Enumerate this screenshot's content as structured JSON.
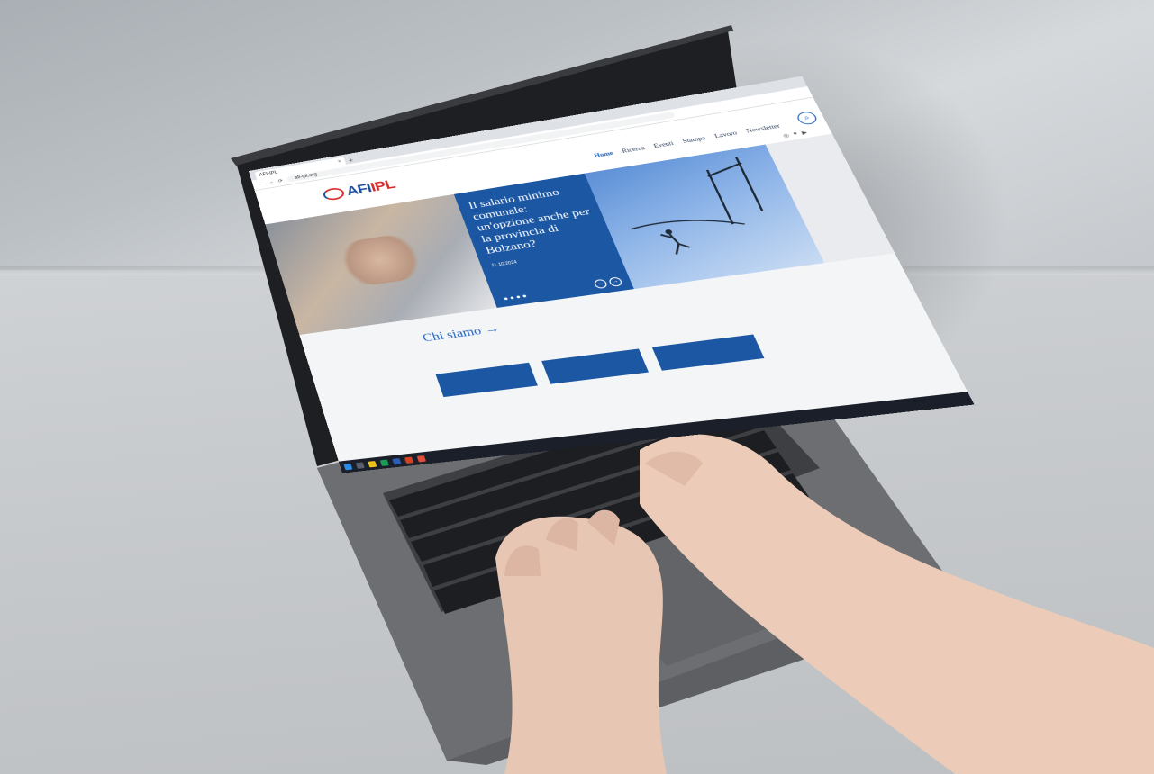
{
  "browser": {
    "tab_title": "AFI-IPL",
    "tab_close": "×",
    "tab_plus": "+",
    "url": "afi-ipl.org"
  },
  "site": {
    "logo_main": "AFI",
    "logo_accent": "IPL",
    "nav": [
      "Home",
      "Ricerca",
      "Eventi",
      "Stampa",
      "Lavoro",
      "Newsletter"
    ],
    "search_icon": "⌕"
  },
  "hero": {
    "title": "Il salario minimo comunale: un'opzione anche per la provincia di Bolzano?",
    "date": "11.10.2024",
    "arrow_left": "←",
    "arrow_right": "→"
  },
  "about": {
    "title": "Chi siamo →"
  },
  "colors": {
    "brand_blue": "#1c57a3",
    "brand_red": "#d52a2a"
  }
}
